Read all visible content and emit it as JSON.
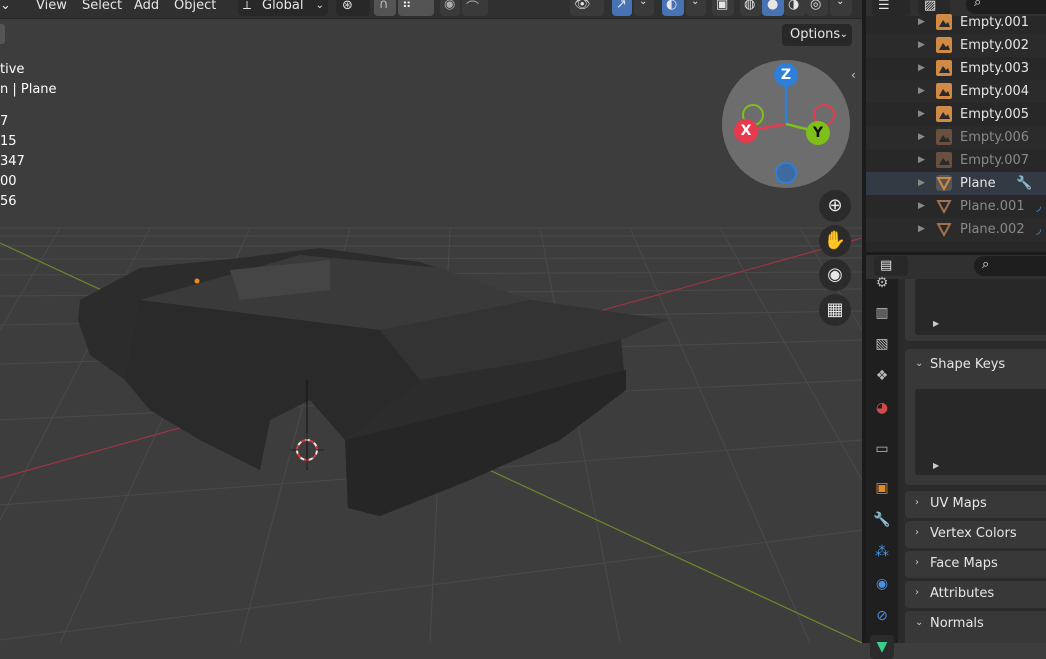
{
  "header": {
    "menus": [
      "View",
      "Select",
      "Add",
      "Object"
    ],
    "orientation": "Global"
  },
  "stats": [
    "tive",
    "n | Plane",
    "7",
    "15",
    "347",
    "00",
    "56"
  ],
  "options_label": "Options",
  "gizmo": {
    "x": "X",
    "y": "Y",
    "z": "Z"
  },
  "nav_icons": [
    "zoom-icon",
    "hand-icon",
    "camera-icon",
    "grid-icon"
  ],
  "outliner": {
    "items": [
      {
        "label": "Empty.001",
        "type": "empty",
        "dim": false
      },
      {
        "label": "Empty.002",
        "type": "empty",
        "dim": false
      },
      {
        "label": "Empty.003",
        "type": "empty",
        "dim": false
      },
      {
        "label": "Empty.004",
        "type": "empty",
        "dim": false
      },
      {
        "label": "Empty.005",
        "type": "empty",
        "dim": false
      },
      {
        "label": "Empty.006",
        "type": "empty",
        "dim": true
      },
      {
        "label": "Empty.007",
        "type": "empty",
        "dim": true
      },
      {
        "label": "Plane",
        "type": "mesh",
        "dim": false
      },
      {
        "label": "Plane.001",
        "type": "mesh",
        "dim": true
      },
      {
        "label": "Plane.002",
        "type": "mesh",
        "dim": true
      }
    ]
  },
  "properties": {
    "panels": {
      "shape_keys": "Shape Keys",
      "uv_maps": "UV Maps",
      "vertex_colors": "Vertex Colors",
      "face_maps": "Face Maps",
      "attributes": "Attributes",
      "normals": "Normals"
    }
  },
  "colors": {
    "x_axis": "#e83a4f",
    "y_axis": "#7fbf1a",
    "z_axis": "#2f7fd8",
    "active_tab": "#4772b3",
    "empty_icon": "#d08a46"
  }
}
